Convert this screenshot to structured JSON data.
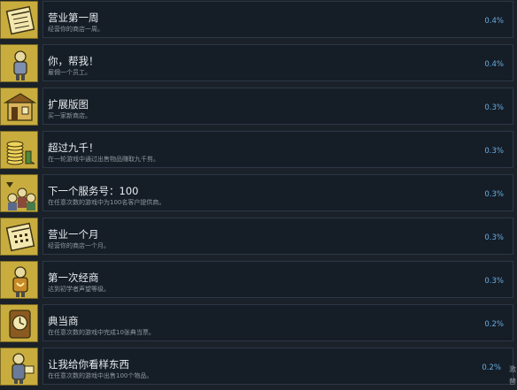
{
  "achievements": [
    {
      "title": "营业第一周",
      "desc": "经营你的商店一周。",
      "percent": "0.4%",
      "icon": "calendar-icon"
    },
    {
      "title": "你，帮我！",
      "desc": "雇佣一个员工。",
      "percent": "0.4%",
      "icon": "employee-icon"
    },
    {
      "title": "扩展版图",
      "desc": "买一家新商店。",
      "percent": "0.3%",
      "icon": "shop-icon"
    },
    {
      "title": "超过九千！",
      "desc": "在一轮游戏中通过出售物品赚取九千剪。",
      "percent": "0.3%",
      "icon": "coins-icon"
    },
    {
      "title": "下一个服务号：100",
      "desc": "在任意次数的游戏中为100名客户提供商。",
      "percent": "0.3%",
      "icon": "customers-icon"
    },
    {
      "title": "营业一个月",
      "desc": "经营你的商店一个月。",
      "percent": "0.3%",
      "icon": "calendar-month-icon"
    },
    {
      "title": "第一次经商",
      "desc": "达到初学者声望等级。",
      "percent": "0.3%",
      "icon": "merchant-icon"
    },
    {
      "title": "典当商",
      "desc": "在任意次数的游戏中完成10张典当票。",
      "percent": "0.2%",
      "icon": "clock-icon"
    },
    {
      "title": "让我给你看样东西",
      "desc": "在任意次数的游戏中出售100个物品。",
      "percent": "0.2%",
      "icon": "seller-icon"
    }
  ],
  "side_text": [
    "激",
    "替"
  ]
}
